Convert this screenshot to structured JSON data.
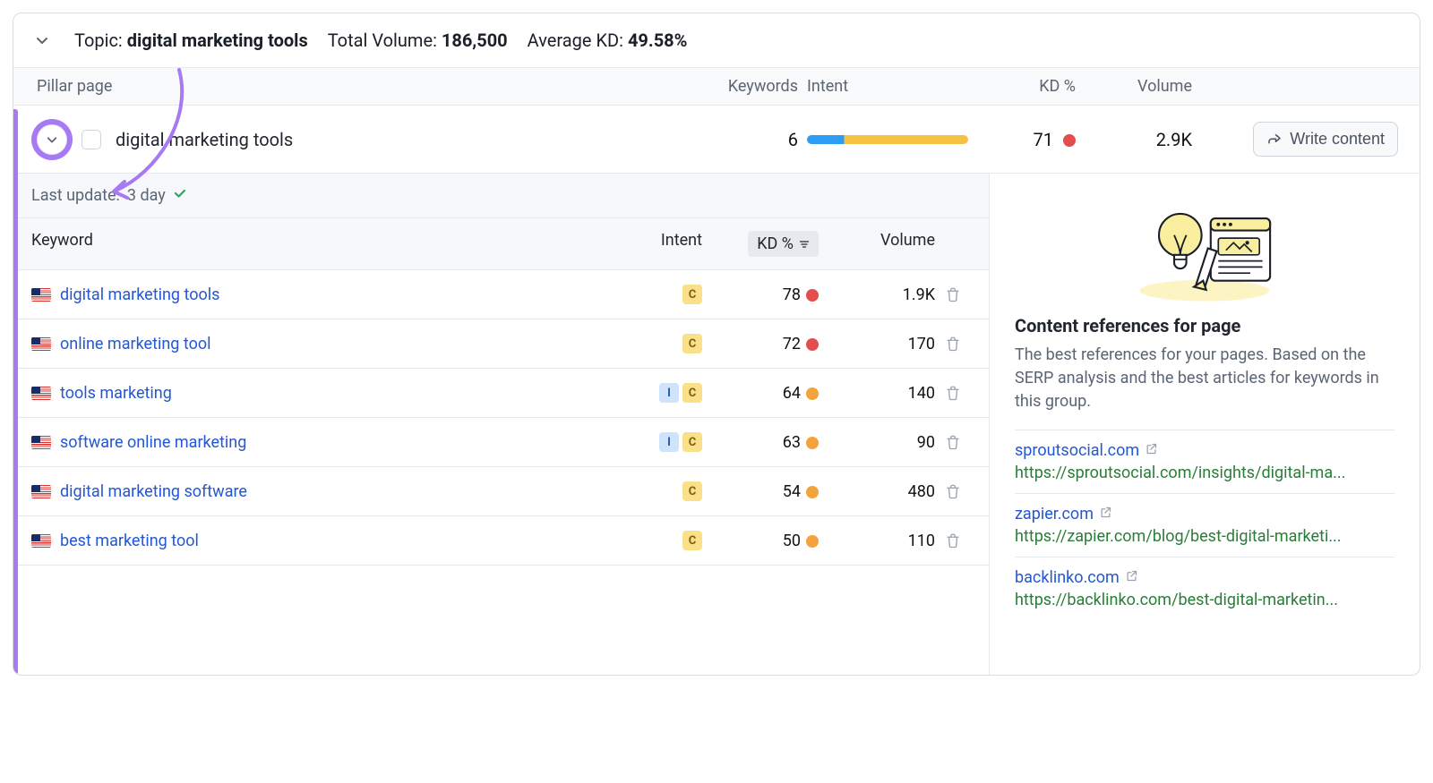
{
  "summary": {
    "topic_label": "Topic:",
    "topic_value": "digital marketing tools",
    "total_volume_label": "Total Volume:",
    "total_volume_value": "186,500",
    "avg_kd_label": "Average KD:",
    "avg_kd_value": "49.58%"
  },
  "columns": {
    "pillar": "Pillar page",
    "keywords": "Keywords",
    "intent": "Intent",
    "kd": "KD %",
    "volume": "Volume"
  },
  "pillar": {
    "title": "digital marketing tools",
    "keywords": "6",
    "intent_blue_pct": 23,
    "kd": "71",
    "kd_dot": "red",
    "volume": "2.9K",
    "write_label": "Write content"
  },
  "last_update": {
    "label": "Last update:",
    "value": "3 day"
  },
  "kw_columns": {
    "keyword": "Keyword",
    "intent": "Intent",
    "kd": "KD %",
    "volume": "Volume"
  },
  "keywords": [
    {
      "flag": "us",
      "name": "digital marketing tools",
      "intents": [
        "C"
      ],
      "kd": "78",
      "kd_dot": "red",
      "volume": "1.9K"
    },
    {
      "flag": "us",
      "name": "online marketing tool",
      "intents": [
        "C"
      ],
      "kd": "72",
      "kd_dot": "red",
      "volume": "170"
    },
    {
      "flag": "us",
      "name": "tools marketing",
      "intents": [
        "I",
        "C"
      ],
      "kd": "64",
      "kd_dot": "orange",
      "volume": "140"
    },
    {
      "flag": "us",
      "name": "software online marketing",
      "intents": [
        "I",
        "C"
      ],
      "kd": "63",
      "kd_dot": "orange",
      "volume": "90"
    },
    {
      "flag": "us",
      "name": "digital marketing software",
      "intents": [
        "C"
      ],
      "kd": "54",
      "kd_dot": "orange",
      "volume": "480"
    },
    {
      "flag": "us",
      "name": "best marketing tool",
      "intents": [
        "C"
      ],
      "kd": "50",
      "kd_dot": "orange",
      "volume": "110"
    }
  ],
  "references": {
    "title": "Content references for page",
    "desc": "The best references for your pages. Based on the SERP analysis and the best articles for keywords in this group.",
    "items": [
      {
        "domain": "sproutsocial.com",
        "url": "https://sproutsocial.com/insights/digital-ma..."
      },
      {
        "domain": "zapier.com",
        "url": "https://zapier.com/blog/best-digital-marketi..."
      },
      {
        "domain": "backlinko.com",
        "url": "https://backlinko.com/best-digital-marketin..."
      }
    ]
  },
  "colors": {
    "accent_purple": "#a779f2",
    "link_blue": "#2457d4",
    "url_green": "#2a7d39",
    "kd_red": "#e34d4d",
    "kd_orange": "#f4a23d"
  }
}
